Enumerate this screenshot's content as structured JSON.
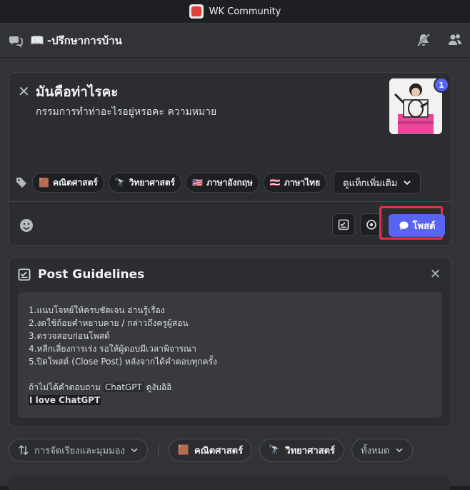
{
  "window": {
    "title": "WK Community"
  },
  "channel": {
    "name": "-ปรึกษาการบ้าน",
    "name_icon": "book-emoji"
  },
  "composer": {
    "title": "มันคือท่าไรคะ",
    "body": "กรรมการทำท่าอะไรอยู่หรอคะ ความหมาย",
    "attachment_count": "1",
    "tags": [
      {
        "emoji": "🟫",
        "label": "คณิตศาสตร์"
      },
      {
        "emoji": "🔭",
        "label": "วิทยาศาสตร์"
      },
      {
        "emoji": "🇺🇸",
        "label": "ภาษาอังกฤษ"
      },
      {
        "emoji": "🇹🇭",
        "label": "ภาษาไทย"
      }
    ],
    "more_tags_label": "ดูแท็กเพิ่มเติม",
    "post_button_label": "โพสต์"
  },
  "guidelines": {
    "title": "Post Guidelines",
    "lines": [
      "1.แนบโจทย์ให้ครบชัดเจน อ่านรู้เรื่อง",
      "2.งดใช้ถ้อยคำหยาบคาย / กล่าวถึงครูผู้สอน",
      "3.ตรวจสอบก่อนโพสต์",
      "4.หลีกเลี่ยงการเร่ง รอให้ผู้ตอบมีเวลาพิจารณา",
      "5.ปิดโพสต์ (Close Post) หลังจากได้คำตอบทุกครั้ง"
    ],
    "footer_prefix": "ถ้าไม่ได้คำตอบถาม ",
    "footer_code": "ChatGPT",
    "footer_suffix": " ดูงับอิอิ",
    "footer_bold": "I love ChatGPT"
  },
  "filters": {
    "sort_label": "การจัดเรียงและมุมมอง",
    "tag1_emoji": "🟫",
    "tag1_label": "คณิตศาสตร์",
    "tag2_emoji": "🔭",
    "tag2_label": "วิทยาศาสตร์",
    "all_label": "ทั้งหมด"
  },
  "colors": {
    "accent": "#5865f2",
    "highlight_outline": "#e8304a",
    "background": "#313338",
    "card": "#2b2d31"
  }
}
